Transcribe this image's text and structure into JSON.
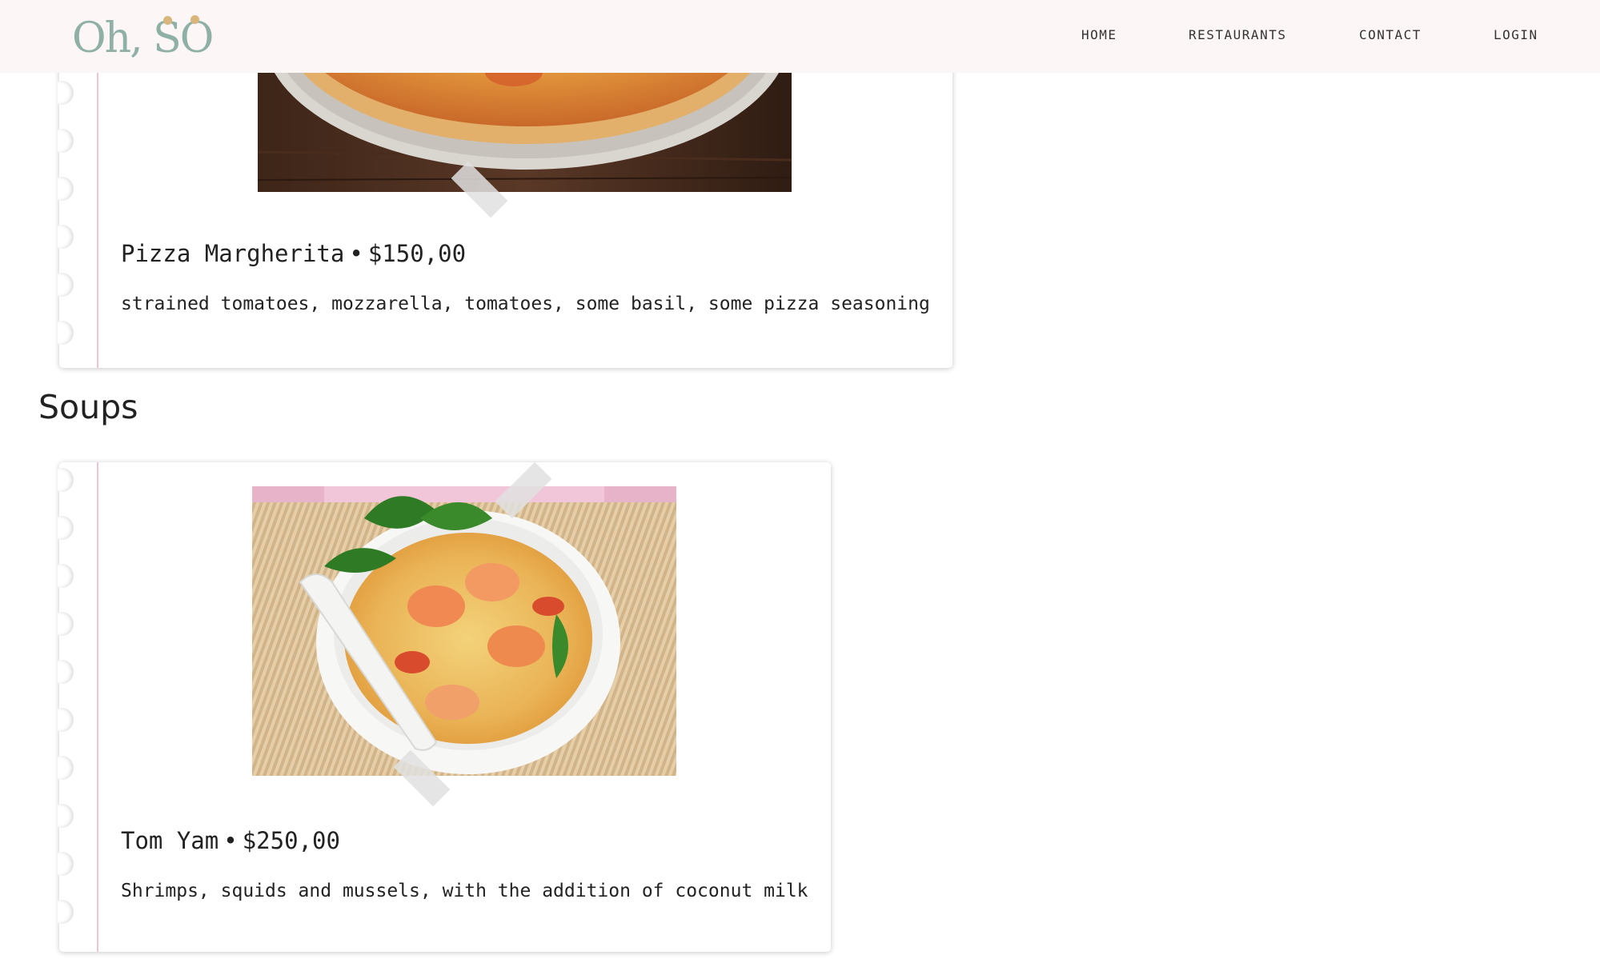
{
  "header": {
    "logo_text": "Oh, SO",
    "nav": {
      "home": "HOME",
      "restaurants": "RESTAURANTS",
      "contact": "CONTACT",
      "login": "LOGIN"
    }
  },
  "menu": {
    "pizza_item": {
      "name": "Pizza Margherita",
      "separator": "•",
      "price": "$150,00",
      "description": "strained tomatoes, mozzarella, tomatoes, some basil, some pizza seasoning"
    },
    "soups_section": {
      "heading": "Soups",
      "items": [
        {
          "name": "Tom Yam",
          "separator": "•",
          "price": "$250,00",
          "description": "Shrimps, squids and mussels, with the addition of coconut milk"
        }
      ]
    }
  },
  "colors": {
    "header_bg": "#fdf6f6",
    "logo_green": "#8fb0a6",
    "logo_gold": "#d9b67c",
    "margin_line": "#efc6cf"
  }
}
